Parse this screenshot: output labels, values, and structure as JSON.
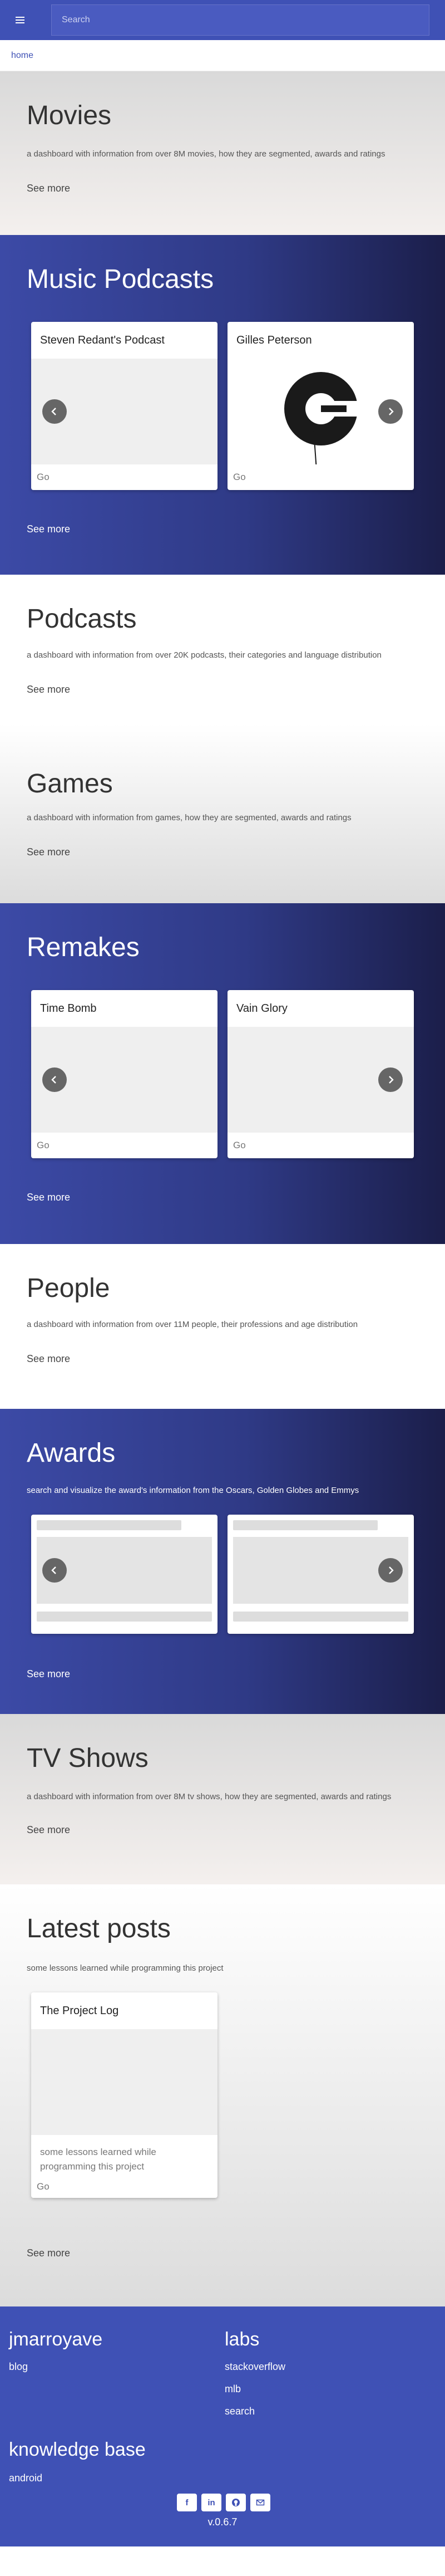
{
  "topbar": {
    "search_placeholder": "Search"
  },
  "breadcrumb": {
    "home": "home"
  },
  "common": {
    "see_more": "See more",
    "go": "Go"
  },
  "movies": {
    "title": "Movies",
    "desc": "a dashboard with information from over 8M movies, how they are segmented, awards and ratings"
  },
  "music_podcasts": {
    "title": "Music Podcasts",
    "cards": [
      "Steven Redant's Podcast",
      "Gilles Peterson"
    ]
  },
  "podcasts": {
    "title": "Podcasts",
    "desc": "a dashboard with information from over 20K podcasts, their categories and language distribution"
  },
  "games": {
    "title": "Games",
    "desc": "a dashboard with information from games, how they are segmented, awards and ratings"
  },
  "remakes": {
    "title": "Remakes",
    "cards": [
      "Time Bomb",
      "Vain Glory"
    ]
  },
  "people": {
    "title": "People",
    "desc": "a dashboard with information from over 11M people, their professions and age distribution"
  },
  "awards": {
    "title": "Awards",
    "desc": "search and visualize the award's information from the Oscars, Golden Globes and Emmys"
  },
  "tvshows": {
    "title": "TV Shows",
    "desc": "a dashboard with information from over 8M tv shows, how they are segmented, awards and ratings"
  },
  "latest_posts": {
    "title": "Latest posts",
    "desc": "some lessons learned while programming this project",
    "card_title": "The Project Log",
    "card_text": "some lessons learned while programming this project"
  },
  "footer": {
    "col1_title": "jmarroyave",
    "col1_links": [
      "blog"
    ],
    "col2_title": "labs",
    "col2_links": [
      "stackoverflow",
      "mlb",
      "search"
    ],
    "col3_title": "knowledge base",
    "col3_links": [
      "android"
    ],
    "social": [
      "facebook-icon",
      "linkedin-icon",
      "github-icon",
      "email-icon"
    ],
    "version": "v.0.6.7"
  },
  "colors": {
    "primary": "#3f51b5",
    "dark_navy": "#1b1e4a",
    "nav_button": "#666666"
  }
}
